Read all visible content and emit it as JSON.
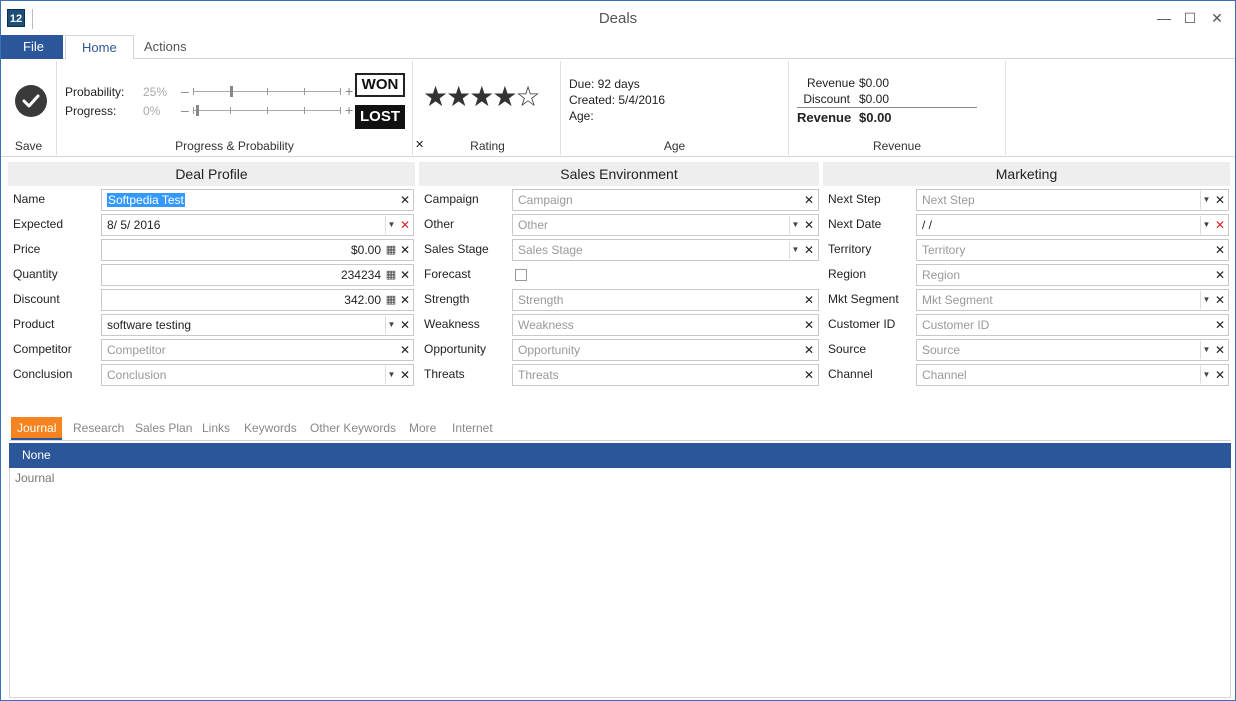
{
  "window": {
    "title": "Deals",
    "logo_text": "12",
    "min_glyph": "—",
    "max_glyph": "☐",
    "close_glyph": "✕"
  },
  "ribbon_tabs": {
    "file": "File",
    "home": "Home",
    "actions": "Actions"
  },
  "ribbon": {
    "save_label": "Save",
    "progress_group_label": "Progress & Probability",
    "probability_label": "Probability:",
    "probability_value": "25%",
    "probability_level": 0.25,
    "progress_label": "Progress:",
    "progress_value": "0%",
    "progress_level": 0.0,
    "won_label": "WON",
    "lost_label": "LOST",
    "rating_label": "Rating",
    "rating_clear": "✕",
    "rating_value": 4,
    "rating_max": 5,
    "age_group_label": "Age",
    "due": "Due: 92 days",
    "created": "Created: 5/4/2016",
    "age": "Age:",
    "revenue_group_label": "Revenue",
    "revenue_label": "Revenue",
    "revenue_value": "$0.00",
    "discount_label": "Discount",
    "discount_value": "$0.00",
    "total_label": "Revenue",
    "total_value": "$0.00"
  },
  "deal_profile": {
    "title": "Deal Profile",
    "name_label": "Name",
    "name_value": "Softpedia Test",
    "expected_label": "Expected",
    "expected_value": "8/    5/    2016",
    "price_label": "Price",
    "price_value": "$0.00",
    "quantity_label": "Quantity",
    "quantity_value": "234234",
    "discount_label": "Discount",
    "discount_value": "342.00",
    "product_label": "Product",
    "product_value": "software testing",
    "competitor_label": "Competitor",
    "competitor_placeholder": "Competitor",
    "conclusion_label": "Conclusion",
    "conclusion_placeholder": "Conclusion"
  },
  "sales_env": {
    "title": "Sales Environment",
    "campaign_label": "Campaign",
    "campaign_placeholder": "Campaign",
    "other_label": "Other",
    "other_placeholder": "Other",
    "stage_label": "Sales Stage",
    "stage_placeholder": "Sales Stage",
    "forecast_label": "Forecast",
    "strength_label": "Strength",
    "strength_placeholder": "Strength",
    "weakness_label": "Weakness",
    "weakness_placeholder": "Weakness",
    "opportunity_label": "Opportunity",
    "opportunity_placeholder": "Opportunity",
    "threats_label": "Threats",
    "threats_placeholder": "Threats"
  },
  "marketing": {
    "title": "Marketing",
    "next_step_label": "Next Step",
    "next_step_placeholder": "Next Step",
    "next_date_label": "Next Date",
    "next_date_value": "/      /",
    "territory_label": "Territory",
    "territory_placeholder": "Territory",
    "region_label": "Region",
    "region_placeholder": "Region",
    "segment_label": "Mkt Segment",
    "segment_placeholder": "Mkt Segment",
    "customer_id_label": "Customer ID",
    "customer_id_placeholder": "Customer ID",
    "source_label": "Source",
    "source_placeholder": "Source",
    "channel_label": "Channel",
    "channel_placeholder": "Channel"
  },
  "bottom_tabs": [
    "Journal",
    "Research",
    "Sales Plan",
    "Links",
    "Keywords",
    "Other Keywords",
    "More",
    "Internet"
  ],
  "journal": {
    "bar_text": "None",
    "placeholder": "Journal"
  },
  "colors": {
    "accent": "#2b579a",
    "active_tab": "#f5831f",
    "selection": "#3399ff"
  }
}
